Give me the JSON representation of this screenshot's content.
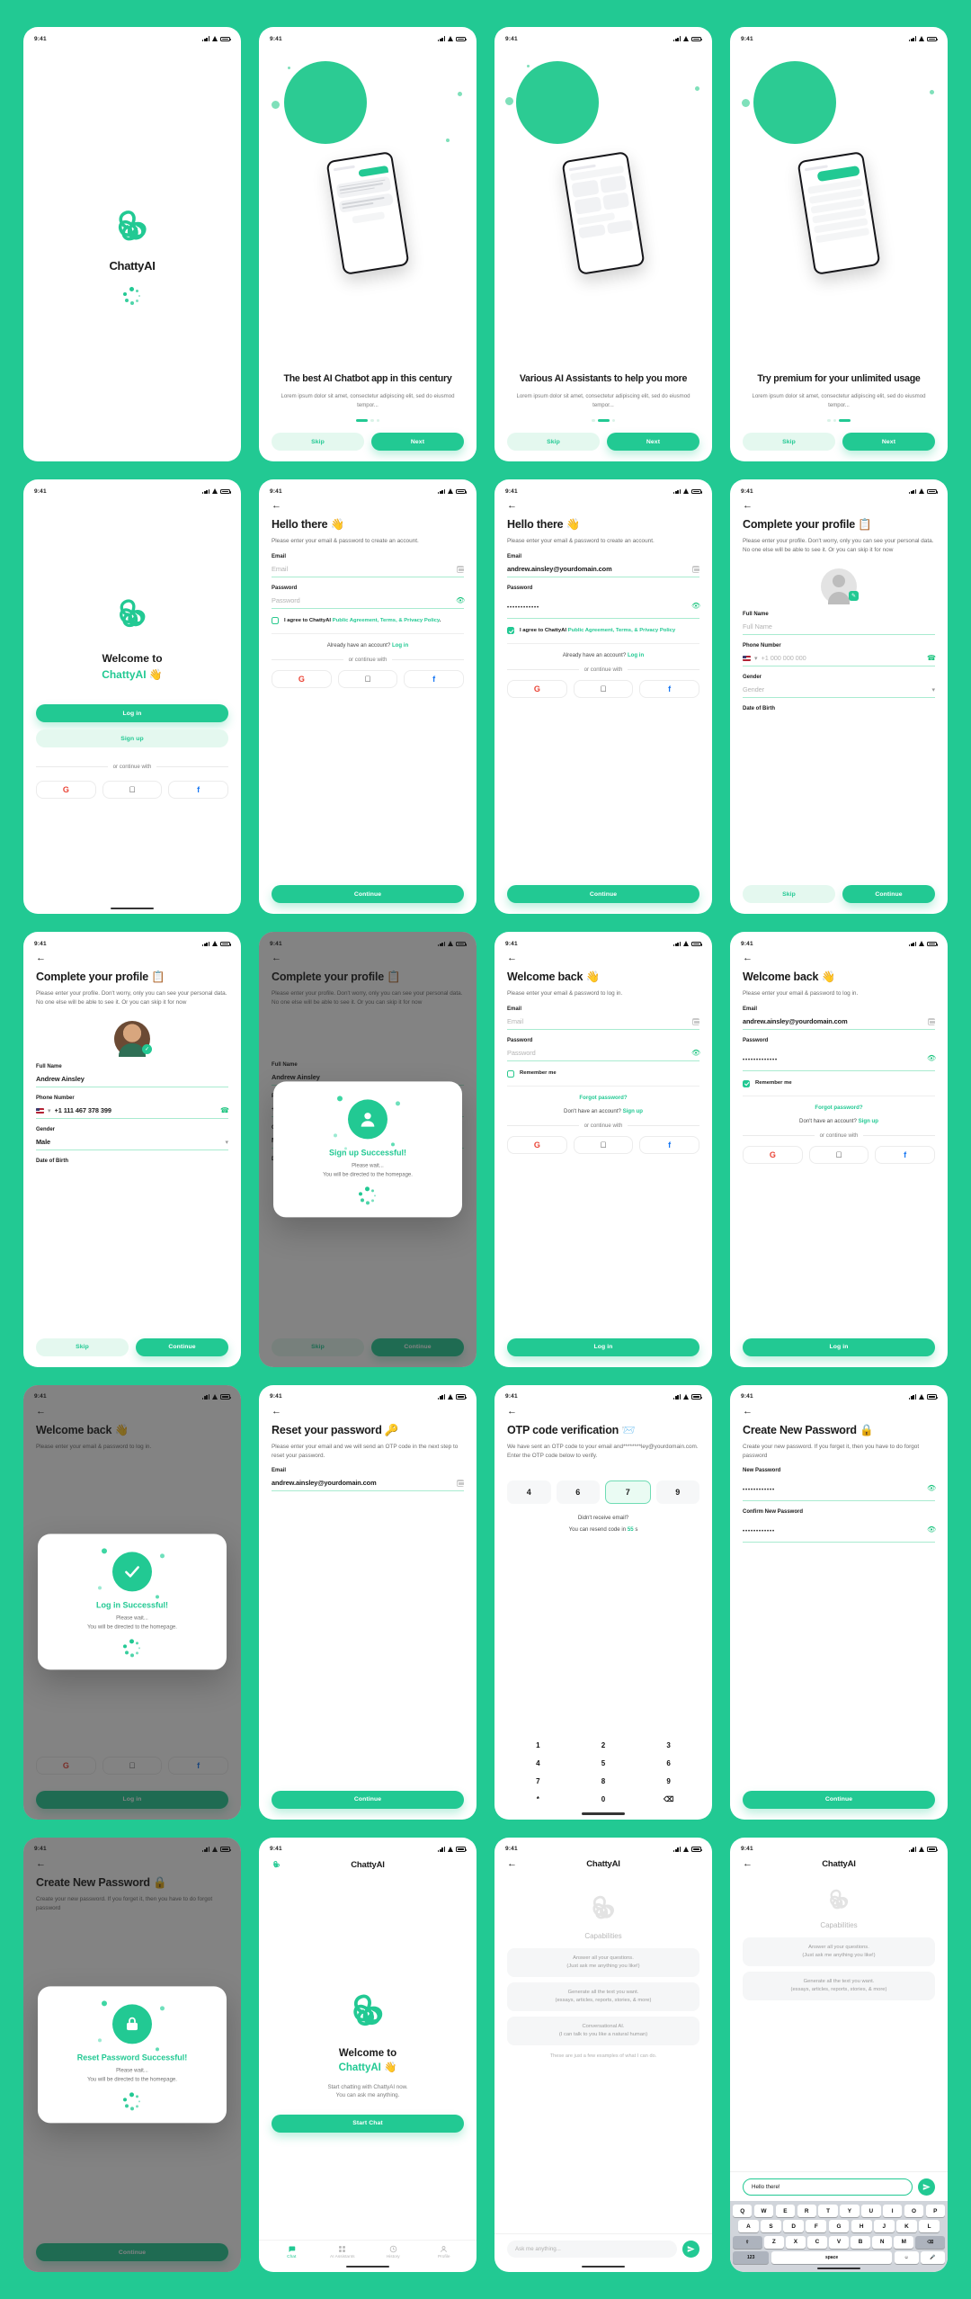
{
  "theme": {
    "brand": "#22C993",
    "brand_light": "#E4F8EF",
    "text": "#1B1B1B",
    "muted": "#7B7B7B"
  },
  "status_bar": {
    "time": "9:41"
  },
  "app": {
    "name": "ChattyAI"
  },
  "screens": {
    "splash": {
      "brand": "ChattyAI"
    },
    "onboarding": [
      {
        "title": "The best AI Chatbot app in this century",
        "desc": "Lorem ipsum dolor sit amet, consectetur adipiscing elit, sed do eiusmod tempor...",
        "skip": "Skip",
        "next": "Next",
        "active_dot": 0
      },
      {
        "title": "Various AI Assistants to help you more",
        "desc": "Lorem ipsum dolor sit amet, consectetur adipiscing elit, sed do eiusmod tempor...",
        "skip": "Skip",
        "next": "Next",
        "active_dot": 1
      },
      {
        "title": "Try premium for your unlimited usage",
        "desc": "Lorem ipsum dolor sit amet, consectetur adipiscing elit, sed do eiusmod tempor...",
        "skip": "Skip",
        "next": "Next",
        "active_dot": 2
      }
    ],
    "welcome": {
      "title_line1": "Welcome to",
      "title_line2": "ChattyAI 👋",
      "login": "Log in",
      "signup": "Sign up",
      "or": "or continue with"
    },
    "signup_empty": {
      "title": "Hello there 👋",
      "desc": "Please enter your email & password to create an account.",
      "email_label": "Email",
      "email_placeholder": "Email",
      "password_label": "Password",
      "password_placeholder": "Password",
      "agree_prefix": "I agree to ChattyAI ",
      "agree_links": "Public Agreement, Terms, & Privacy Policy",
      "agree_suffix": ".",
      "have_account": "Already have an account?",
      "login_link": "Log in",
      "or": "or continue with",
      "continue": "Continue"
    },
    "signup_filled": {
      "title": "Hello there 👋",
      "desc": "Please enter your email & password to create an account.",
      "email_label": "Email",
      "email_value": "andrew.ainsley@yourdomain.com",
      "password_label": "Password",
      "password_value": "••••••••••••",
      "agree_prefix": "I agree to ChattyAI ",
      "agree_links": "Public Agreement, Terms, & Privacy Policy",
      "have_account": "Already have an account?",
      "login_link": "Log in",
      "or": "or continue with",
      "continue": "Continue"
    },
    "profile_empty": {
      "title": "Complete your profile 📋",
      "desc": "Please enter your profile. Don't worry, only you can see your personal data. No one else will be able to see it. Or you can skip it for now",
      "fullname_label": "Full Name",
      "fullname_placeholder": "Full Name",
      "phone_label": "Phone Number",
      "phone_placeholder": "+1 000 000 000",
      "gender_label": "Gender",
      "gender_placeholder": "Gender",
      "dob_label": "Date of Birth",
      "skip": "Skip",
      "continue": "Continue"
    },
    "profile_filled": {
      "title": "Complete your profile 📋",
      "desc": "Please enter your profile. Don't worry, only you can see your personal data. No one else will be able to see it. Or you can skip it for now",
      "fullname_label": "Full Name",
      "fullname_value": "Andrew Ainsley",
      "phone_label": "Phone Number",
      "phone_value": "+1 111 467 378 399",
      "gender_label": "Gender",
      "gender_value": "Male",
      "dob_label": "Date of Birth",
      "skip": "Skip",
      "continue": "Continue"
    },
    "signup_success": {
      "title": "Sign up Successful!",
      "line1": "Please wait...",
      "line2": "You will be directed to the homepage."
    },
    "login_empty": {
      "title": "Welcome back 👋",
      "desc": "Please enter your email & password to log in.",
      "email_label": "Email",
      "email_placeholder": "Email",
      "password_label": "Password",
      "password_placeholder": "Password",
      "remember": "Remember me",
      "forgot": "Forgot password?",
      "no_account": "Don't have an account?",
      "signup_link": "Sign up",
      "or": "or continue with",
      "login": "Log in"
    },
    "login_filled": {
      "title": "Welcome back 👋",
      "desc": "Please enter your email & password to log in.",
      "email_label": "Email",
      "email_value": "andrew.ainsley@yourdomain.com",
      "password_label": "Password",
      "password_value": "•••••••••••••",
      "remember": "Remember me",
      "forgot": "Forgot password?",
      "no_account": "Don't have an account?",
      "signup_link": "Sign up",
      "or": "or continue with",
      "login": "Log in"
    },
    "login_success": {
      "title": "Log in Successful!",
      "line1": "Please wait...",
      "line2": "You will be directed to the homepage.",
      "bg_title": "Welcome back 👋",
      "button": "Log in"
    },
    "reset_password": {
      "title": "Reset your password 🔑",
      "desc": "Please enter your email and we will send an OTP code in the next step to reset your password.",
      "email_label": "Email",
      "email_value": "andrew.ainsley@yourdomain.com",
      "continue": "Continue"
    },
    "otp": {
      "title": "OTP code verification 📨",
      "desc": "We have sent an OTP code to your email and********ley@yourdomain.com. Enter the OTP code below to verify.",
      "digits": [
        "4",
        "6",
        "7",
        "9"
      ],
      "selected_index": 2,
      "resend_q": "Didn't receive email?",
      "resend_text": "You can resend code in",
      "resend_seconds": "55",
      "resend_unit": "s",
      "keypad": [
        "1",
        "2",
        "3",
        "4",
        "5",
        "6",
        "7",
        "8",
        "9",
        "*",
        "0",
        "⌫"
      ]
    },
    "create_password": {
      "title": "Create New Password 🔒",
      "desc": "Create your new password. If you forget it, then you have to do forgot password",
      "new_label": "New Password",
      "new_value": "••••••••••••",
      "confirm_label": "Confirm New Password",
      "confirm_value": "••••••••••••",
      "continue": "Continue"
    },
    "reset_success": {
      "title": "Reset Password Successful!",
      "line1": "Please wait...",
      "line2": "You will be directed to the homepage.",
      "bg_title": "Create New Password 🔒",
      "button": "Continue"
    },
    "chat_welcome": {
      "header": "ChattyAI",
      "title_line1": "Welcome to",
      "title_line2": "ChattyAI 👋",
      "desc_line1": "Start chatting with ChattyAI now.",
      "desc_line2": "You can ask me anything.",
      "button": "Start Chat",
      "tabs": [
        {
          "label": "Chat",
          "icon": "chat-icon"
        },
        {
          "label": "AI Assistants",
          "icon": "grid-icon"
        },
        {
          "label": "History",
          "icon": "clock-icon"
        },
        {
          "label": "Profile",
          "icon": "person-icon"
        }
      ]
    },
    "capabilities": {
      "header": "ChattyAI",
      "heading": "Capabilities",
      "items": [
        {
          "line1": "Answer all your questions.",
          "line2": "(Just ask me anything you like!)"
        },
        {
          "line1": "Generate all the text you want.",
          "line2": "(essays, articles, reports, stories, & more)"
        },
        {
          "line1": "Conversational AI.",
          "line2": "(I can talk to you like a natural human)"
        }
      ],
      "note": "These are just a few examples of what I can do.",
      "input_placeholder": "Ask me anything...",
      "send_icon": "send-icon"
    },
    "capabilities_typing": {
      "header": "ChattyAI",
      "heading": "Capabilities",
      "input_value": "Hello there!",
      "keyboard": {
        "row1": [
          "Q",
          "W",
          "E",
          "R",
          "T",
          "Y",
          "U",
          "I",
          "O",
          "P"
        ],
        "row2": [
          "A",
          "S",
          "D",
          "F",
          "G",
          "H",
          "J",
          "K",
          "L"
        ],
        "row3": [
          "⇧",
          "Z",
          "X",
          "C",
          "V",
          "B",
          "N",
          "M",
          "⌫"
        ],
        "row4_left": "123",
        "row4_space": "space",
        "row4_emoji": "☺",
        "row4_mic": "🎤"
      }
    }
  }
}
